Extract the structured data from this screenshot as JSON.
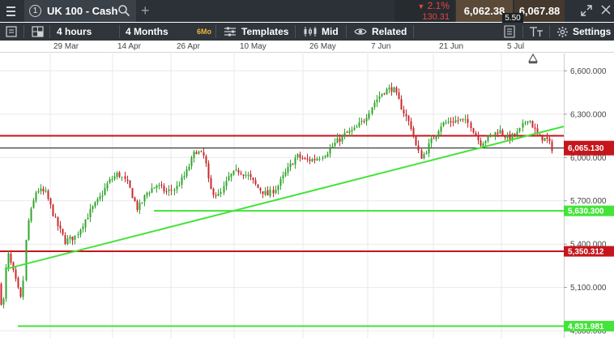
{
  "header": {
    "tab_number": "1",
    "tab_title": "UK 100 - Cash",
    "change_arrow": "▼",
    "change_pct": "2.1%",
    "change_abs": "130.31",
    "sell_price": "6,062.38",
    "buy_price": "6,067.88",
    "spread": "5.50",
    "icons": [
      "menu-icon",
      "search-icon",
      "plus-icon",
      "expand-icon",
      "close-icon"
    ]
  },
  "toolbar": {
    "interval": "4 hours",
    "range": "4 Months",
    "range_badge": "6Mo",
    "templates_label": "Templates",
    "price_type_label": "Mid",
    "related_label": "Related",
    "settings_label": "Settings",
    "icons": [
      "layout-icon",
      "grid-icon",
      "templates-icon",
      "candles-icon",
      "eye-icon",
      "indicator-icon",
      "text-size-icon",
      "gear-icon"
    ]
  },
  "date_axis": [
    "29 Mar",
    "14 Apr",
    "26 Apr",
    "10 May",
    "26 May",
    "7 Jun",
    "21 Jun",
    "5 Jul"
  ],
  "price_axis": [
    "6,600.000",
    "6,300.000",
    "6,000.000",
    "5,700.000",
    "5,400.000",
    "5,100.000",
    "4,800.000"
  ],
  "price_axis_values": [
    6600,
    6300,
    6000,
    5700,
    5400,
    5100,
    4800
  ],
  "price_tags": {
    "current": "6,065.130",
    "support_upper": "5,630.300",
    "resistance_lower": "5,350.312",
    "support_lower": "4,831.981"
  },
  "colors": {
    "up_candle": "#2fa52b",
    "down_candle": "#c9282d",
    "support_line": "#44e33a",
    "resistance_line": "#c5161c",
    "current_price": "#111111",
    "topbar": "#2b3137",
    "toolbar": "#2f353b"
  },
  "chart_data": {
    "type": "candlestick",
    "ylim": [
      4750,
      6720
    ],
    "xlim": [
      "2020-03-18",
      "2020-07-13"
    ],
    "price_levels": [
      {
        "name": "current",
        "value": 6065.13
      },
      {
        "name": "resistance_upper",
        "value": 6150
      },
      {
        "name": "support_upper",
        "value": 5630.3
      },
      {
        "name": "resistance_lower",
        "value": 5350.312
      },
      {
        "name": "support_lower",
        "value": 4831.981
      }
    ],
    "trendline": [
      [
        "2020-03-19",
        5226
      ],
      [
        "2020-07-13",
        6215
      ]
    ],
    "price_path": [
      [
        "2020-03-18",
        5160
      ],
      [
        "2020-03-19",
        4930
      ],
      [
        "2020-03-20",
        5350
      ],
      [
        "2020-03-23",
        4995
      ],
      [
        "2020-03-24",
        5520
      ],
      [
        "2020-03-26",
        5780
      ],
      [
        "2020-03-28",
        5750
      ],
      [
        "2020-03-30",
        5560
      ],
      [
        "2020-04-01",
        5420
      ],
      [
        "2020-04-03",
        5450
      ],
      [
        "2020-04-06",
        5620
      ],
      [
        "2020-04-08",
        5710
      ],
      [
        "2020-04-10",
        5830
      ],
      [
        "2020-04-12",
        5890
      ],
      [
        "2020-04-14",
        5810
      ],
      [
        "2020-04-16",
        5640
      ],
      [
        "2020-04-18",
        5760
      ],
      [
        "2020-04-20",
        5810
      ],
      [
        "2020-04-22",
        5760
      ],
      [
        "2020-04-24",
        5790
      ],
      [
        "2020-04-26",
        5890
      ],
      [
        "2020-04-28",
        6050
      ],
      [
        "2020-04-30",
        6000
      ],
      [
        "2020-05-01",
        5780
      ],
      [
        "2020-05-03",
        5730
      ],
      [
        "2020-05-05",
        5870
      ],
      [
        "2020-05-07",
        5910
      ],
      [
        "2020-05-09",
        5870
      ],
      [
        "2020-05-11",
        5790
      ],
      [
        "2020-05-13",
        5740
      ],
      [
        "2020-05-15",
        5800
      ],
      [
        "2020-05-17",
        5910
      ],
      [
        "2020-05-19",
        6010
      ],
      [
        "2020-05-21",
        5980
      ],
      [
        "2020-05-23",
        5990
      ],
      [
        "2020-05-25",
        6030
      ],
      [
        "2020-05-27",
        6100
      ],
      [
        "2020-05-29",
        6160
      ],
      [
        "2020-05-31",
        6190
      ],
      [
        "2020-06-02",
        6260
      ],
      [
        "2020-06-04",
        6380
      ],
      [
        "2020-06-06",
        6460
      ],
      [
        "2020-06-08",
        6480
      ],
      [
        "2020-06-10",
        6330
      ],
      [
        "2020-06-12",
        6200
      ],
      [
        "2020-06-13",
        6050
      ],
      [
        "2020-06-14",
        6000
      ],
      [
        "2020-06-16",
        6120
      ],
      [
        "2020-06-18",
        6230
      ],
      [
        "2020-06-20",
        6250
      ],
      [
        "2020-06-22",
        6260
      ],
      [
        "2020-06-24",
        6230
      ],
      [
        "2020-06-26",
        6100
      ],
      [
        "2020-06-28",
        6140
      ],
      [
        "2020-06-30",
        6190
      ],
      [
        "2020-07-02",
        6130
      ],
      [
        "2020-07-04",
        6170
      ],
      [
        "2020-07-06",
        6280
      ],
      [
        "2020-07-08",
        6150
      ],
      [
        "2020-07-10",
        6120
      ],
      [
        "2020-07-11",
        6065
      ]
    ]
  }
}
